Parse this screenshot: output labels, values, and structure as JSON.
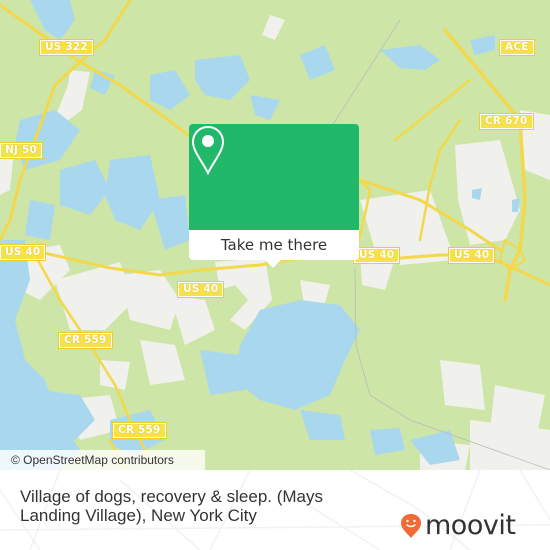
{
  "map": {
    "colors": {
      "land": "#cde5a7",
      "water": "#a9d8ee",
      "urban": "#f0f0ec",
      "road": "#f6e14b",
      "popup_accent": "#21b86a",
      "logo_pin": "#f26a36"
    },
    "road_labels": [
      {
        "id": "us322",
        "text": "US 322"
      },
      {
        "id": "ace",
        "text": "ACE"
      },
      {
        "id": "cr670",
        "text": "CR 670"
      },
      {
        "id": "nj50",
        "text": "NJ 50"
      },
      {
        "id": "us40-west",
        "text": "US 40"
      },
      {
        "id": "us40-mid",
        "text": "US 40"
      },
      {
        "id": "us40-center",
        "text": "US 40"
      },
      {
        "id": "us40-east",
        "text": "US 40"
      },
      {
        "id": "cr559-north",
        "text": "CR 559"
      },
      {
        "id": "cr559-south",
        "text": "CR 559"
      }
    ],
    "attribution": "© OpenStreetMap contributors"
  },
  "popup": {
    "icon": "map-pin-icon",
    "button_label": "Take me there"
  },
  "footer": {
    "place_name": "Village of dogs, recovery & sleep. (Mays Landing Village), New York City",
    "logo_text": "moovit",
    "logo_icon": "moovit-pin-icon"
  }
}
